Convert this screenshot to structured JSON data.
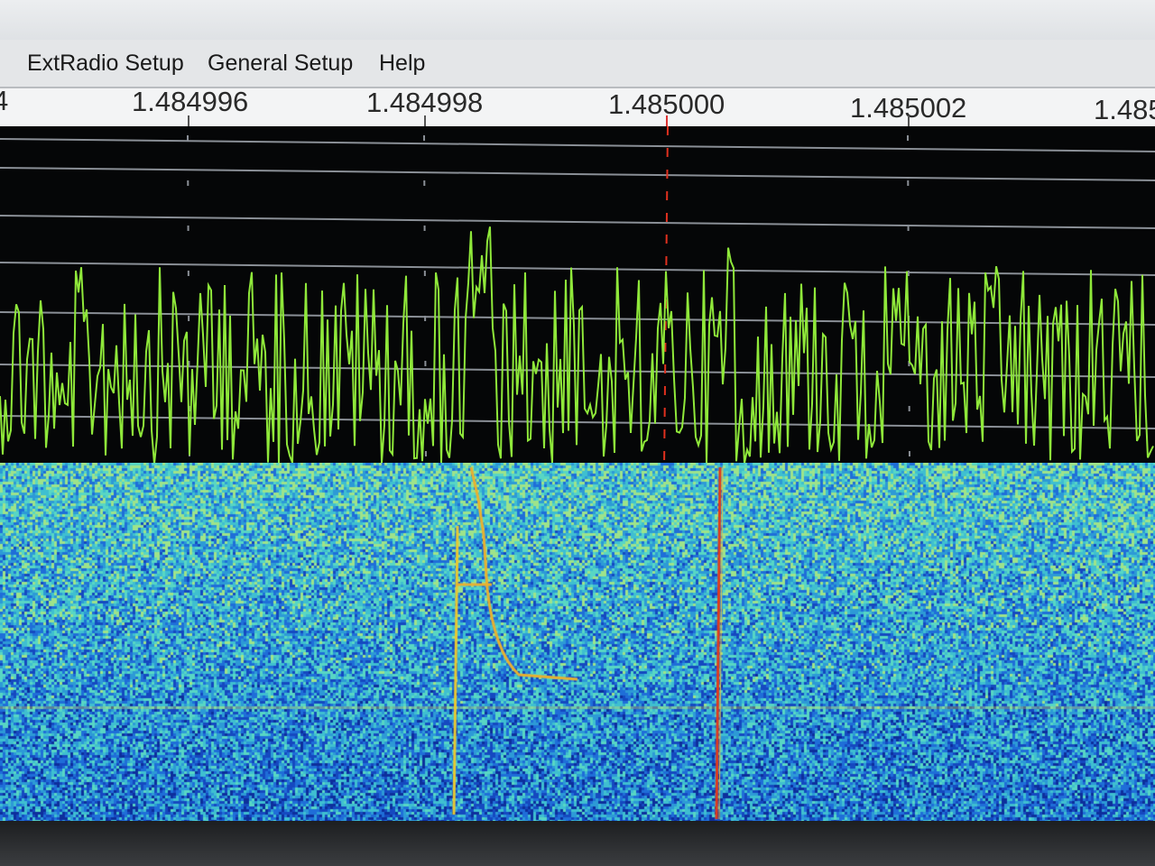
{
  "menu": {
    "items": [
      {
        "label": "ExtRadio Setup"
      },
      {
        "label": "General Setup"
      },
      {
        "label": "Help"
      }
    ]
  },
  "frequency_scale": {
    "labels": [
      "4",
      "1.484996",
      "1.484998",
      "1.485000",
      "1.485002",
      "1.485"
    ]
  },
  "colors": {
    "spectrum_trace": "#8fe83a",
    "center_marker": "#e0301e",
    "waterfall_base": "#2d9ad6"
  },
  "icons": [
    "center-frequency-marker"
  ]
}
